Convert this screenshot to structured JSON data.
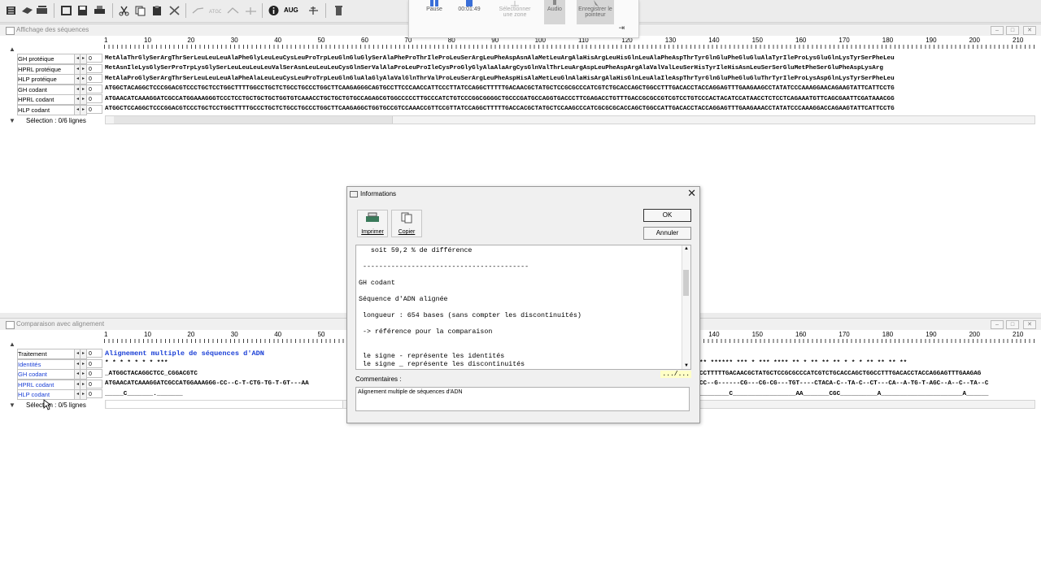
{
  "toolbar": {
    "aug_label": "AUG"
  },
  "recorder": {
    "pause_label": "Pause",
    "time": "00:01:49",
    "select_zone_label": "Sélectionner une zone",
    "audio_label": "Audio",
    "pointer_label": "Enregistrer le pointeur"
  },
  "top_window": {
    "title": "Affichage des séquences",
    "ruler": [
      "1",
      "10",
      "20",
      "30",
      "40",
      "50",
      "60",
      "70",
      "80",
      "90",
      "100",
      "110",
      "120",
      "130",
      "140",
      "150",
      "160",
      "170",
      "180",
      "190",
      "200",
      "210"
    ],
    "rows": [
      {
        "label": "GH protéique",
        "count": "0",
        "seq": "MetAlaThrGlySerArgThrSerLeuLeuLeuAlaPheGlyLeuLeuCysLeuProTrpLeuGlnGluGlySerAlaPheProThrIleProLeuSerArgLeuPheAspAsnAlaMetLeuArgAlaHisArgLeuHisGlnLeuAlaPheAspThrTyrGlnGluPheGluGluAlaTyrIleProLysGluGlnLysTyrSerPheLeu"
      },
      {
        "label": "HPRL protéique",
        "count": "0",
        "seq": "MetAsnIleLysGlySerProTrpLysGlySerLeuLeuLeuLeuValSerAsnLeuLeuLeuCysGlnSerValAlaProLeuProIleCysProGlyGlyAlaAlaArgCysGlnValThrLeuArgAspLeuPheAspArgAlaValValLeuSerHisTyrIleHisAsnLeuSerSerGluMetPheSerGluPheAspLysArg"
      },
      {
        "label": "HLP protéique",
        "count": "0",
        "seq": "MetAlaProGlySerArgThrSerLeuLeuLeuAlaPheAlaLeuLeuCysLeuProTrpLeuGlnGluAlaGlyAlaValGlnThrValProLeuSerArgLeuPheAspHisAlaMetLeuGlnAlaHisArgAlaHisGlnLeuAlaIleAspThrTyrGlnGluPheGluGluThrTyrIleProLysAspGlnLysTyrSerPheLeu"
      },
      {
        "label": "GH codant",
        "count": "0",
        "seq": "ATGGCTACAGGCTCCCGGACGTCCCTGCTCCTGGCTTTTGGCCTGCTCTGCCTGCCCTGGCTTCAAGAGGGCAGTGCCTTCCCAACCATTCCCTTATCCAGGCTTTTTGACAACGCTATGCTCCGCGCCCATCGTCTGCACCAGCTGGCCTTTGACACCTACCAGGAGTTTGAAGAAGCCTATATCCCAAAGGAACAGAAGTATTCATTCCTG"
      },
      {
        "label": "HPRL codant",
        "count": "0",
        "seq": "ATGAACATCAAAGGATCGCCATGGAAAGGGTCCCTCCTGCTGCTGCTGGTGTCAAACCTGCTGCTGTGCCAGAGCGTGGCCCCCTTGCCCATCTGTCCCGGCGGGGCTGCCCGATGCCAGGTGACCCTTCGAGACCTGTTTGACCGCGCCGTCGTCCTGTCCCACTACATCCATAACCTCTCCTCAGAAATGTTCAGCGAATTCGATAAACGG"
      },
      {
        "label": "HLP codant",
        "count": "0",
        "seq": "ATGGCTCCAGGCTCCCGGACGTCCCTGCTCCTGGCTTTTGCCCTGCTCTGCCTGCCCTGGCTTCAAGAGGCTGGTGCCGTCCAAACCGTTCCGTTATCCAGGCTTTTTGACCACGCTATGCTCCAAGCCCATCGCGCGCACCAGCTGGCCATTGACACCTACCAGGAGTTTGAAGAAACCTATATCCCAAAGGACCAGAAGTATTCATTCCTG"
      }
    ],
    "selection": "Sélection : 0/6 lignes"
  },
  "bottom_window": {
    "title": "Comparaison avec alignement",
    "ruler_left": [
      "1",
      "10",
      "20",
      "30",
      "40",
      "50"
    ],
    "ruler_right": [
      "140",
      "150",
      "160",
      "170",
      "180",
      "190",
      "200",
      "210"
    ],
    "rows": [
      {
        "label": "Traitement",
        "count": "0",
        "seq_left": "Alignement multiple de séquences d'ADN",
        "seq_right": ""
      },
      {
        "label": "Identités",
        "count": "0",
        "seq_left": "                                *  * *  *   *  * *  ***",
        "seq_right": " ** ******  ***  *  ***  ****       **  * **  **   ** *  *  *   ** ** **  **"
      },
      {
        "label": "GH codant",
        "count": "0",
        "seq_left": "                               _ATGGCTACAGGCTCC_CGGACGTC",
        "seq_right": "CCTTTTTGACAACGCTATGCTCCGCGCCCATCGTCTGCACCAGCTGGCCTTTGACACCTACCAGGAGTTTGAAGAG"
      },
      {
        "label": "HPRL codant",
        "count": "0",
        "seq_left": "ATGAACATCAAAGGATCGCCATGGAAAGGG-CC--C-T-CTG-TG-T-GT---AA",
        "seq_right": "CC--G------CG---CG-CG---TGT----CTACA-C--TA-C--CT---CA--A-TG-T-AGC--A--C--TA--C"
      },
      {
        "label": "HLP codant",
        "count": "0",
        "seq_left": "                               _____C_______._______",
        "seq_right": "________C_________________AA_______CGC__________A______________________A______"
      }
    ],
    "selection": "Sélection : 0/5 lignes"
  },
  "dialog": {
    "title": "Informations",
    "print_label": "Imprimer",
    "copy_label": "Copier",
    "ok_label": "OK",
    "cancel_label": "Annuler",
    "lines": [
      "   soit 59,2 % de différence",
      "",
      " -----------------------------------------",
      "",
      "GH codant",
      "",
      "Séquence d'ADN alignée",
      "",
      " longueur : 654 bases (sans compter les discontinuités)",
      "",
      " -> référence pour la comparaison",
      "",
      "",
      " le signe - représente les identités",
      " le signe _ représente les discontinuités"
    ],
    "page_indicator": ".../...",
    "comments_label": "Commentaires :",
    "comments_value": "Alignement multiple de séquences d'ADN"
  }
}
